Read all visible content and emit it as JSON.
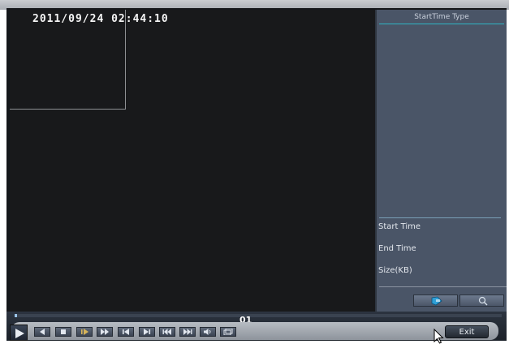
{
  "osd": {
    "datetime": "2011/09/24 02:44:10"
  },
  "panel": {
    "header": "StartTime Type",
    "start_time_label": "Start Time",
    "end_time_label": "End Time",
    "size_label": "Size(KB)"
  },
  "playback": {
    "channel": "01",
    "progress_fraction": 0.005,
    "exit_label": "Exit"
  },
  "icons": {
    "play": "play-icon",
    "rewind": "rewind-icon",
    "stop": "stop-icon",
    "slow": "slow-play-icon",
    "fast": "fast-forward-icon",
    "prev_frame": "prev-frame-icon",
    "next_frame": "next-frame-icon",
    "skip_back": "skip-back-icon",
    "skip_forward": "skip-forward-icon",
    "volume": "volume-icon",
    "snapshot": "snapshot-icon",
    "file": "file-icon",
    "search": "search-icon"
  }
}
